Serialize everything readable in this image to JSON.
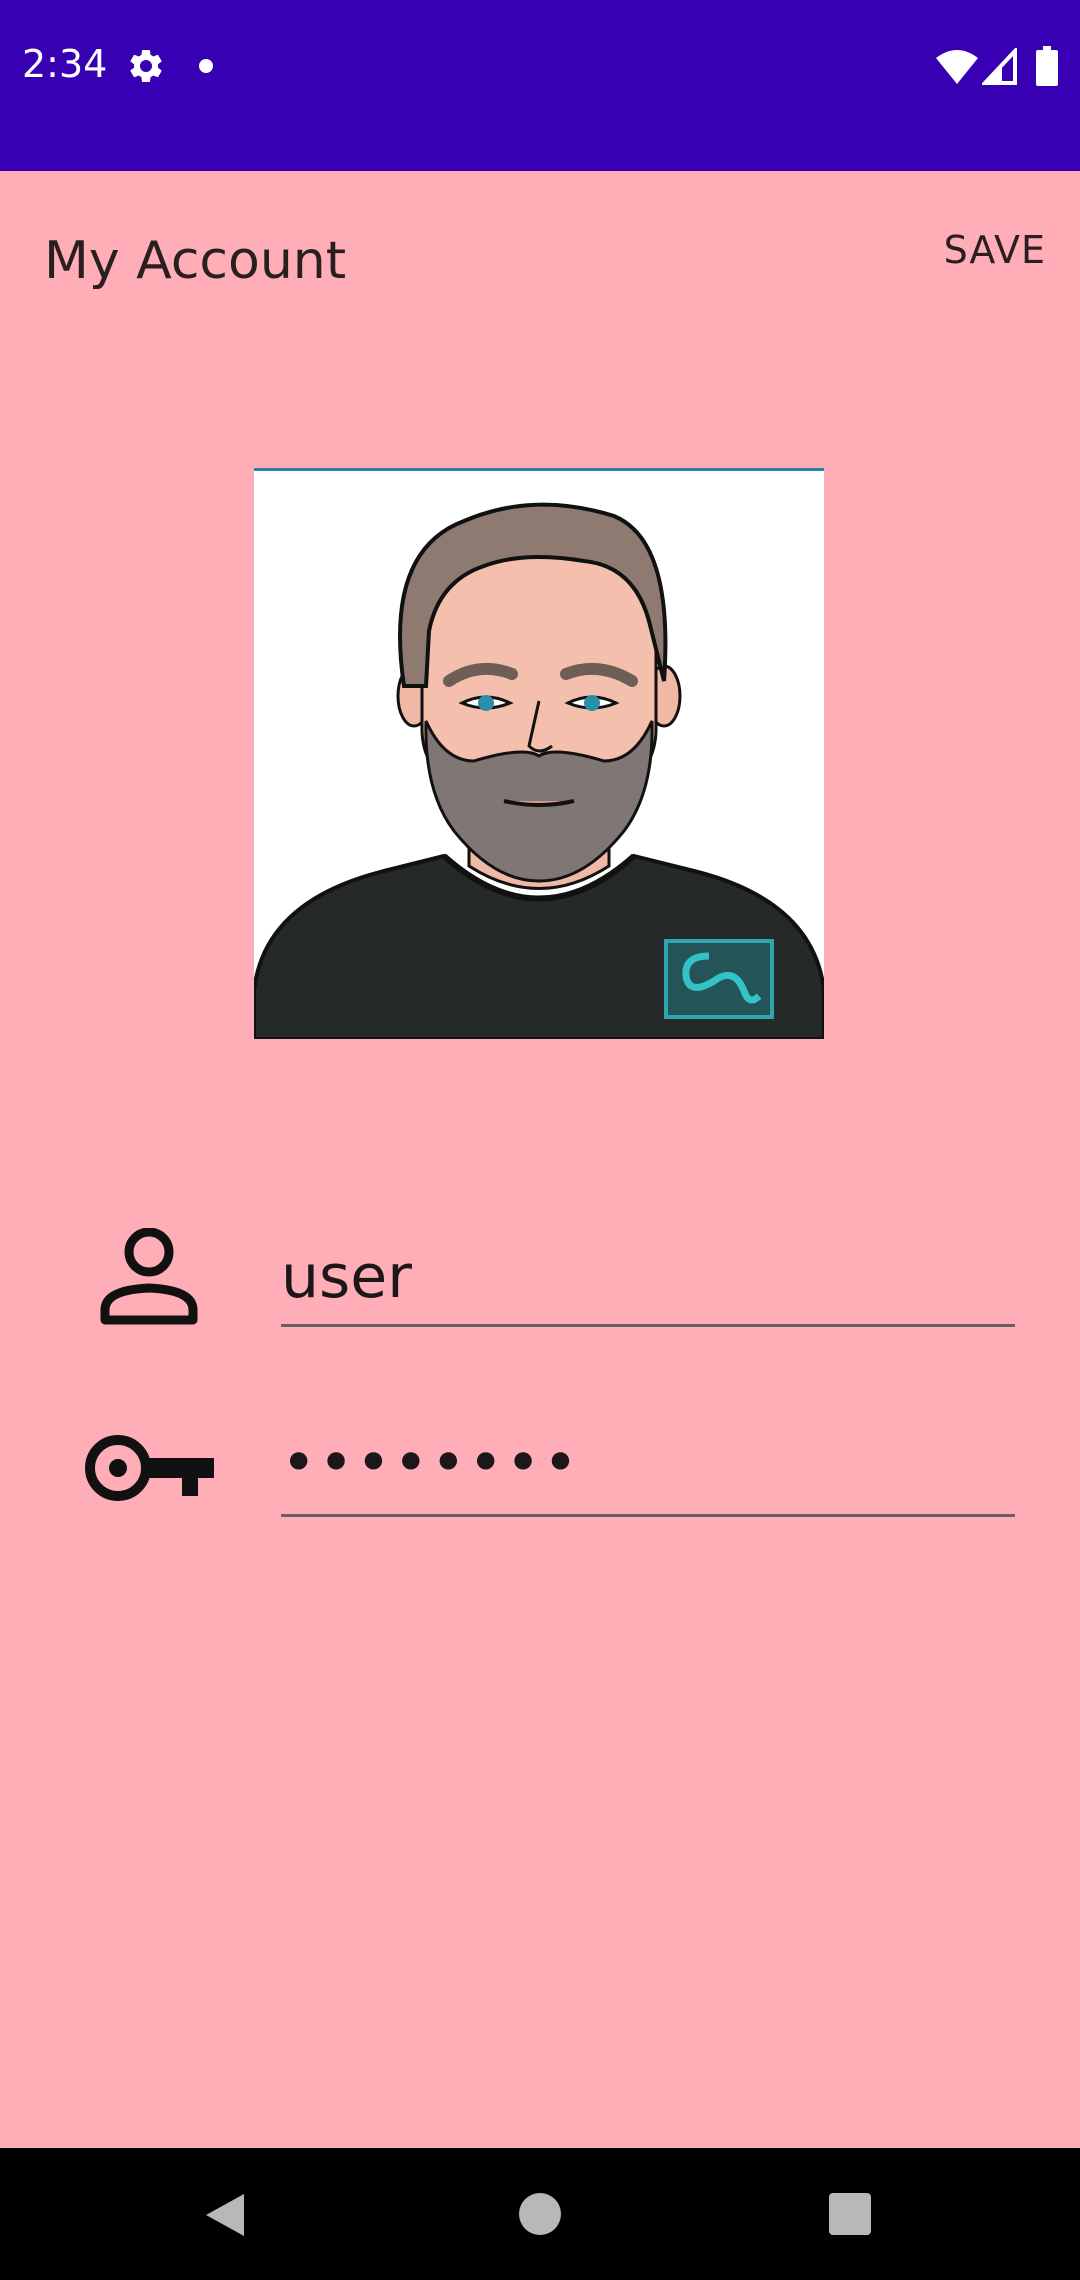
{
  "status_bar": {
    "time": "2:34",
    "background_color": "#3700B3",
    "icons": [
      "gear-icon",
      "notification-dot-icon",
      "wifi-icon",
      "signal-icon",
      "battery-icon"
    ]
  },
  "toolbar": {
    "title": "My Account",
    "save_label": "SAVE"
  },
  "profile": {
    "avatar_icon": "avatar-photo"
  },
  "form": {
    "username": {
      "icon": "person-icon",
      "value": "user"
    },
    "password": {
      "icon": "key-icon",
      "value": "••••••••"
    }
  },
  "nav_bar": {
    "icons": [
      "back-icon",
      "home-icon",
      "recents-icon"
    ]
  },
  "colors": {
    "background": "#FFADB7",
    "status_bar": "#3700B3",
    "text": "#2A1F20"
  }
}
